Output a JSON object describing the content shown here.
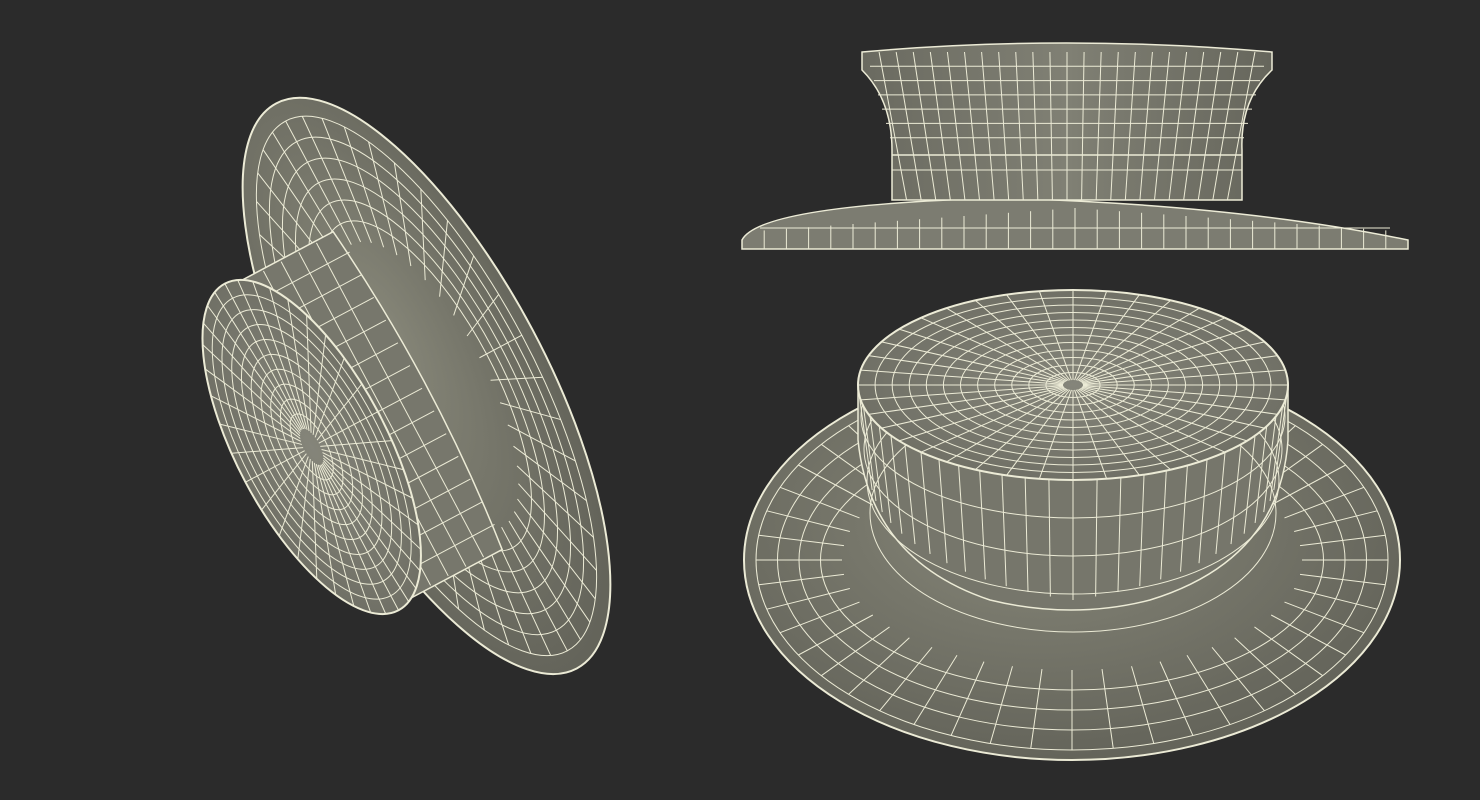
{
  "scene": {
    "subject": "boater-hat-wireframe",
    "background_color": "#2b2b2b",
    "surface_color": "#7a7a6f",
    "surface_shadow_color": "#5f5f56",
    "wire_color": "#ecebd6"
  },
  "views": [
    {
      "id": "perspective-side",
      "name": "tilted-side-view"
    },
    {
      "id": "front-elevation",
      "name": "front-view"
    },
    {
      "id": "top-perspective",
      "name": "top-perspective-view"
    }
  ]
}
